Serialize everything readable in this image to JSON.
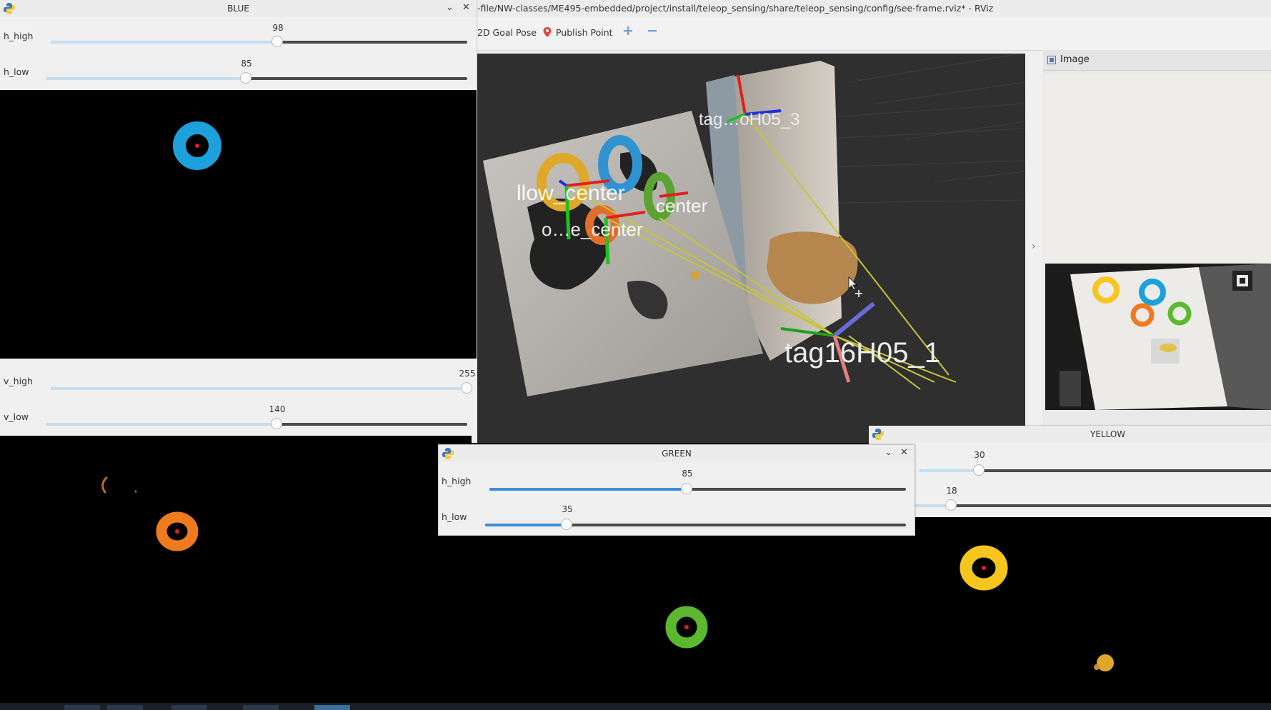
{
  "rviz": {
    "title": "-file/NW-classes/ME495-embedded/project/install/teleop_sensing/share/teleop_sensing/config/see-frame.rviz* - RViz",
    "tools": {
      "goal_pose": "2D Goal Pose",
      "publish_point": "Publish Point"
    },
    "viewport_labels": {
      "tag3": "tag16H05_3",
      "tag3_visible": "tag…oH05_3",
      "yellow_center": "llow_center",
      "green_center": "center",
      "orange_center": "o…e_center",
      "tag1": "tag16H05_1"
    },
    "image_panel": {
      "title": "Image"
    }
  },
  "windows": {
    "blue": {
      "title": "BLUE",
      "h_high": {
        "label": "h_high",
        "value": "98",
        "fraction": 0.545
      },
      "h_low": {
        "label": "h_low",
        "value": "85",
        "fraction": 0.475
      },
      "v_high": {
        "label": "v_high",
        "value": "255",
        "fraction": 1.0
      },
      "v_low": {
        "label": "v_low",
        "value": "140",
        "fraction": 0.549
      }
    },
    "green": {
      "title": "GREEN",
      "h_high": {
        "label": "h_high",
        "value": "85",
        "fraction": 0.475
      },
      "h_low": {
        "label": "h_low",
        "value": "35",
        "fraction": 0.196
      }
    },
    "yellow": {
      "title": "YELLOW",
      "h_high": {
        "value": "30",
        "fraction": 0.168
      },
      "h_low": {
        "value": "18",
        "fraction": 0.101
      }
    }
  },
  "colors": {
    "blue_ring": "#1da1dd",
    "orange_ring": "#f07a1e",
    "green_ring": "#5cb82e",
    "yellow_ring": "#f6c51f",
    "slider_fill_active": "#3b8fd6",
    "slider_fill_inactive": "#c5ddf0",
    "rviz_background": "#2f2f2f"
  },
  "icons": [
    "python-logo-icon",
    "chevron-down-icon",
    "close-icon",
    "publish-point-pin-icon",
    "zoom-plus-icon",
    "zoom-minus-icon",
    "image-panel-icon",
    "collapse-arrow-icon",
    "mouse-cursor-icon"
  ]
}
